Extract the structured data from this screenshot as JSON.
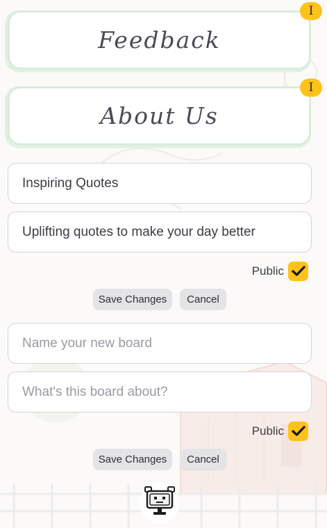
{
  "cards": [
    {
      "title": "Feedback",
      "badge": "I"
    },
    {
      "title": "About Us",
      "badge": "I"
    }
  ],
  "board_edit": {
    "name_value": "Inspiring Quotes",
    "description_value": "Uplifting quotes to make your day better",
    "public_label": "Public",
    "public_checked": true,
    "save_label": "Save Changes",
    "cancel_label": "Cancel"
  },
  "board_new": {
    "name_placeholder": "Name your new board",
    "description_placeholder": "What's this board about?",
    "public_label": "Public",
    "public_checked": true,
    "save_label": "Save Changes",
    "cancel_label": "Cancel"
  },
  "colors": {
    "accent": "#ffc21a",
    "card_border": "#d9ecd9",
    "button_bg": "#e4e4e6"
  },
  "icons": {
    "badge": "info-badge-icon",
    "check": "checkmark-icon",
    "mascot": "robot-mascot-icon"
  }
}
